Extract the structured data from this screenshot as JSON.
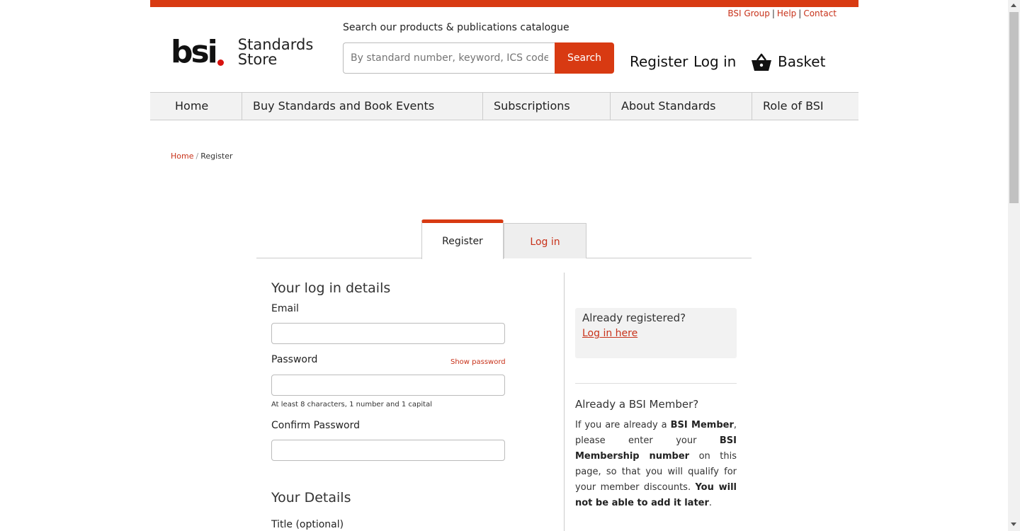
{
  "util_links": {
    "bsi_group": "BSI Group",
    "help": "Help",
    "contact": "Contact",
    "sep": "|"
  },
  "logo": {
    "mark": "bsi",
    "line1": "Standards",
    "line2": "Store"
  },
  "search": {
    "label": "Search our products & publications catalogue",
    "placeholder": "By standard number, keyword, ICS code, ISBN",
    "button": "Search"
  },
  "header": {
    "register": "Register",
    "login": "Log in",
    "basket": "Basket"
  },
  "nav": {
    "home": "Home",
    "buy": "Buy Standards and Book Events",
    "subscriptions": "Subscriptions",
    "about": "About Standards",
    "role": "Role of BSI"
  },
  "breadcrumb": {
    "home": "Home",
    "sep": "/",
    "current": "Register"
  },
  "tabs": {
    "register": "Register",
    "login": "Log in"
  },
  "form": {
    "login_details_title": "Your log in details",
    "email_label": "Email",
    "password_label": "Password",
    "show_password": "Show password",
    "password_hint": "At least 8 characters, 1 number and 1 capital",
    "confirm_label": "Confirm Password",
    "your_details_title": "Your Details",
    "title_label": "Title (optional)"
  },
  "sidebar": {
    "already_registered": "Already registered?",
    "login_here": "Log in here",
    "member_title": "Already a BSI Member?",
    "member_p1": "If you are already a ",
    "member_b1": "BSI Member",
    "member_p2": ", please enter your ",
    "member_b2": "BSI Membership number",
    "member_p3": " on this page, so that you will qualify for your member discounts. ",
    "member_b3": "You will not be able to add it later",
    "member_p4": "."
  },
  "colors": {
    "accent": "#d83a12",
    "link": "#c8321a",
    "nav_bg": "#f2f2f2"
  }
}
